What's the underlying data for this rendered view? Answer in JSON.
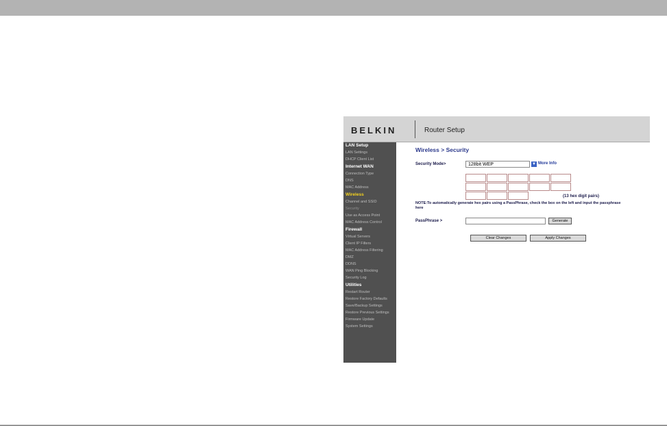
{
  "router": {
    "brand": "BELKIN",
    "title": "Router Setup"
  },
  "sidebar": {
    "sections": [
      {
        "heading": "LAN Setup",
        "items": [
          "LAN Settings",
          "DHCP Client List"
        ]
      },
      {
        "heading": "Internet WAN",
        "items": [
          "Connection Type",
          "DNS",
          "MAC Address"
        ]
      },
      {
        "heading": "Wireless",
        "items": [
          "Channel and SSID",
          "Security",
          "Use as Access Point",
          "MAC Address Control"
        ]
      },
      {
        "heading": "Firewall",
        "items": [
          "Virtual Servers",
          "Client IP Filters",
          "MAC Address Filtering",
          "DMZ",
          "DDNS",
          "WAN Ping Blocking",
          "Security Log"
        ]
      },
      {
        "heading": "Utilities",
        "items": [
          "Restart Router",
          "Restore Factory Defaults",
          "Save/Backup Settings",
          "Restore Previous Settings",
          "Firmware Update",
          "System Settings"
        ]
      }
    ]
  },
  "content": {
    "breadcrumb": "Wireless > Security",
    "security_mode_label": "Security Mode>",
    "security_mode_value": "128bit WEP",
    "more_info": "More Info",
    "hex_note": "(13 hex digit pairs)",
    "note": "NOTE:To automatically generate hex pairs using a PassPhrase, check the box on the left and input the passphrase here",
    "passphrase_label": "PassPhrase >",
    "generate_button": "Generate",
    "clear_button": "Clear Changes",
    "apply_button": "Apply Changes"
  },
  "colors": {
    "sidebar_bg": "#505050",
    "active_section": "#f4d21f",
    "heading_blue": "#2d3a8c"
  }
}
